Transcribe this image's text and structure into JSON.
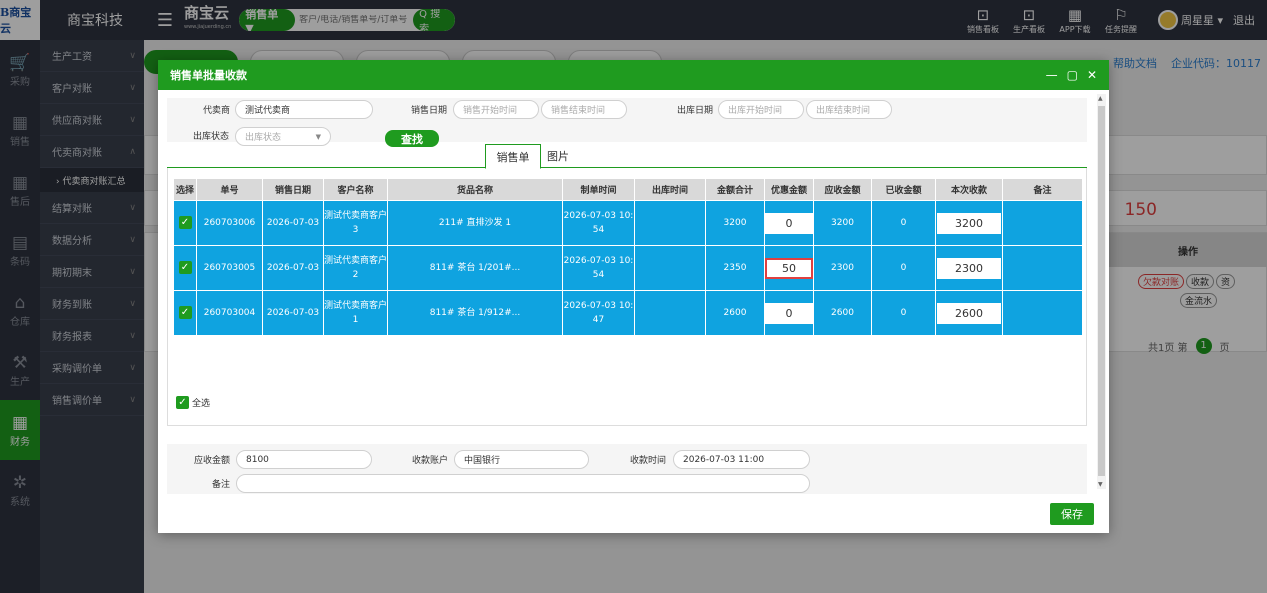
{
  "app": {
    "logo_text": "B商宝云",
    "company_name": "商宝科技",
    "brand_name": "商宝云",
    "brand_sub": "www.jiajuerding.cn"
  },
  "search": {
    "type_label": "销售单 ▼",
    "placeholder": "客户/电话/销售单号/订单号",
    "button_label": "Q 搜索"
  },
  "top_actions": [
    {
      "icon": "chart-board-icon",
      "label": "销售看板"
    },
    {
      "icon": "production-board-icon",
      "label": "生产看板"
    },
    {
      "icon": "qrcode-icon",
      "label": "APP下载"
    },
    {
      "icon": "flag-icon",
      "label": "任务提醒"
    }
  ],
  "user": {
    "name": "周星星 ▾",
    "logout": "退出"
  },
  "icon_nav": [
    {
      "icon": "cart-icon",
      "label": "采购",
      "glyph": "🛒"
    },
    {
      "icon": "sales-icon",
      "label": "销售",
      "glyph": "▦"
    },
    {
      "icon": "after-sales-icon",
      "label": "售后",
      "glyph": "▦"
    },
    {
      "icon": "barcode-icon",
      "label": "条码",
      "glyph": "▤"
    },
    {
      "icon": "warehouse-icon",
      "label": "仓库",
      "glyph": "⌂"
    },
    {
      "icon": "production-icon",
      "label": "生产",
      "glyph": "⚒"
    },
    {
      "icon": "finance-icon",
      "label": "财务",
      "glyph": "▦"
    },
    {
      "icon": "system-icon",
      "label": "系统",
      "glyph": "✲"
    }
  ],
  "sub_nav": [
    {
      "label": "生产工资",
      "chev": "∨"
    },
    {
      "label": "客户对账",
      "chev": "∨"
    },
    {
      "label": "供应商对账",
      "chev": "∨"
    },
    {
      "label": "代卖商对账",
      "chev": "∧"
    },
    {
      "label": "› 代卖商对账汇总",
      "sub": true
    },
    {
      "label": "结算对账",
      "chev": "∨"
    },
    {
      "label": "数据分析",
      "chev": "∨"
    },
    {
      "label": "期初期末",
      "chev": "∨"
    },
    {
      "label": "财务到账",
      "chev": "∨"
    },
    {
      "label": "财务报表",
      "chev": "∨"
    },
    {
      "label": "采购调价单",
      "chev": "∨"
    },
    {
      "label": "销售调价单",
      "chev": "∨"
    }
  ],
  "background": {
    "help_link": "帮助文档",
    "corp_code": "企业代码：10117",
    "total": "150",
    "ops_header": "操作",
    "op_debt": "欠款对账",
    "op_collect": "收款",
    "op_more": "资",
    "op_flow": "金流水",
    "pager_total": "共1页 第",
    "pager_page": "1",
    "pager_unit": "页"
  },
  "modal": {
    "title": "销售单批量收款",
    "btn_min": "—",
    "btn_max": "▢",
    "btn_close": "✕",
    "filters": {
      "agent_label": "代卖商",
      "agent_value": "测试代卖商",
      "sales_date_label": "销售日期",
      "sales_start_ph": "销售开始时间",
      "sales_end_ph": "销售结束时间",
      "out_date_label": "出库日期",
      "out_start_ph": "出库开始时间",
      "out_end_ph": "出库结束时间",
      "out_status_label": "出库状态",
      "out_status_value": "出库状态",
      "search_label": "查找"
    },
    "tabs": [
      "销售单",
      "图片"
    ],
    "columns": [
      "选择",
      "单号",
      "销售日期",
      "客户名称",
      "货品名称",
      "制单时间",
      "出库时间",
      "金额合计",
      "优惠金额",
      "应收金额",
      "已收金额",
      "本次收款",
      "备注"
    ],
    "rows": [
      {
        "checked": "✓",
        "no": "260703006",
        "date": "2026-07-03",
        "customer": "测试代卖商客户3",
        "goods": "211# 直排沙发 1",
        "made": "2026-07-03 10:54",
        "out": "",
        "total": "3200",
        "discount": "0",
        "receivable": "3200",
        "received": "0",
        "this_pay": "3200",
        "remark": ""
      },
      {
        "checked": "✓",
        "no": "260703005",
        "date": "2026-07-03",
        "customer": "测试代卖商客户2",
        "goods": "811# 茶台 1/201#...",
        "made": "2026-07-03 10:54",
        "out": "",
        "total": "2350",
        "discount": "50",
        "receivable": "2300",
        "received": "0",
        "this_pay": "2300",
        "remark": ""
      },
      {
        "checked": "✓",
        "no": "260703004",
        "date": "2026-07-03",
        "customer": "测试代卖商客户1",
        "goods": "811# 茶台 1/912#...",
        "made": "2026-07-03 10:47",
        "out": "",
        "total": "2600",
        "discount": "0",
        "receivable": "2600",
        "received": "0",
        "this_pay": "2600",
        "remark": ""
      }
    ],
    "select_all_check": "✓",
    "select_all_label": "全选",
    "footer": {
      "receivable_label": "应收金额",
      "receivable_value": "8100",
      "account_label": "收款账户",
      "account_value": "中国银行",
      "time_label": "收款时间",
      "time_value": "2026-07-03 11:00",
      "remark_label": "备注",
      "remark_value": ""
    },
    "save_label": "保存"
  },
  "colors": {
    "accent": "#1f9b1f",
    "row_selected": "#0fa3e0",
    "dark_nav": "#2e3340",
    "highlight": "#e04040"
  }
}
